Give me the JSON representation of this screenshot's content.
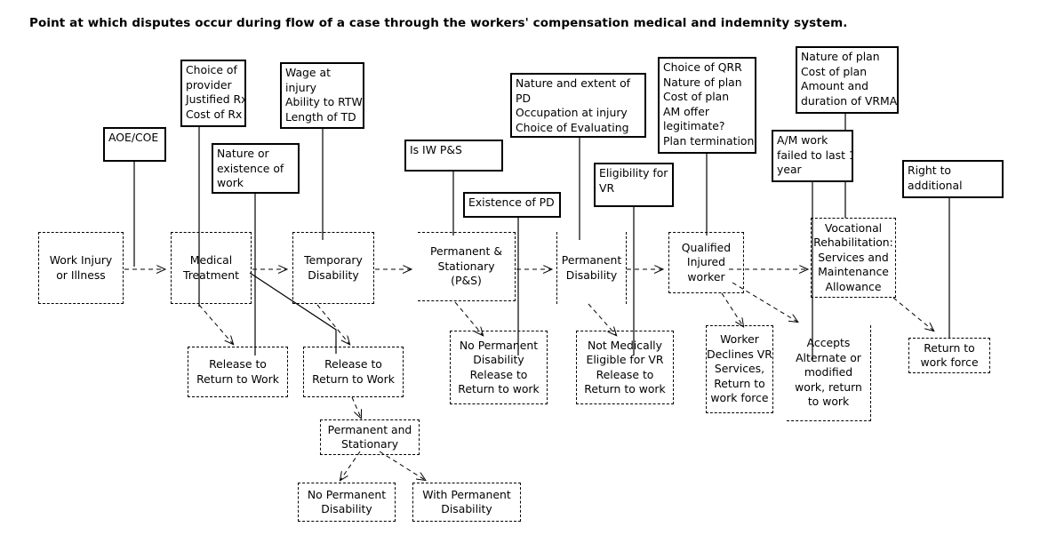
{
  "title": "Point at which disputes occur during flow of a case through the workers' compensation medical and indemnity system.",
  "dispute_boxes": [
    {
      "id": "aoe-coe",
      "text": "AOE/COE"
    },
    {
      "id": "choice-provider",
      "text": "Choice of\nprovider\nJustified Rx\nCost of Rx"
    },
    {
      "id": "wage-injury",
      "text": "Wage at\ninjury\nAbility to RTW\nLength of TD"
    },
    {
      "id": "nature-work",
      "text": "Nature or\nexistence of\nwork"
    },
    {
      "id": "is-iw-ps",
      "text": "Is IW P&S"
    },
    {
      "id": "existence-pd",
      "text": "Existence of PD"
    },
    {
      "id": "nature-extent-pd",
      "text": "Nature and extent of\nPD\nOccupation at injury\nChoice of Evaluating\nphysician"
    },
    {
      "id": "eligibility-vr",
      "text": "Eligibility for\nVR"
    },
    {
      "id": "choice-qrr",
      "text": "Choice of QRR\nNature of plan\nCost of plan\nAM offer\nlegitimate?\nPlan termination"
    },
    {
      "id": "nature-plan",
      "text": "Nature of plan\nCost of plan\nAmount and\nduration of VRMA"
    },
    {
      "id": "am-work-failed",
      "text": "A/M work\nfailed to last 1\nyear"
    },
    {
      "id": "right-additional",
      "text": "Right to\nadditional"
    }
  ],
  "process_boxes": [
    {
      "id": "work-injury",
      "text": "Work Injury\nor Illness"
    },
    {
      "id": "medical-treatment",
      "text": "Medical\nTreatment"
    },
    {
      "id": "temporary-disability",
      "text": "Temporary\nDisability"
    },
    {
      "id": "permanent-stationary",
      "text": "Permanent &\nStationary\n(P&S)"
    },
    {
      "id": "permanent-disability",
      "text": "Permanent\nDisability"
    },
    {
      "id": "qualified-injured-worker",
      "text": "Qualified\nInjured\nworker"
    },
    {
      "id": "vocational-rehab",
      "text": "Vocational\nRehabilitation:\nServices and\nMaintenance\nAllowance"
    },
    {
      "id": "release-rtw-1",
      "text": "Release to\nReturn to Work"
    },
    {
      "id": "release-rtw-2",
      "text": "Release to\nReturn to Work"
    },
    {
      "id": "no-pd-release",
      "text": "No Permanent\nDisability\nRelease to\nReturn to work"
    },
    {
      "id": "not-med-eligible",
      "text": "Not Medically\nEligible for VR\nRelease to\nReturn to work"
    },
    {
      "id": "worker-declines",
      "text": "Worker\nDeclines VR\nServices,\nReturn to\nwork force"
    },
    {
      "id": "accepts-alt-work",
      "text": "Accepts\nAlternate or\nmodified\nwork, return\nto work"
    },
    {
      "id": "return-workforce",
      "text": "Return to\nwork force"
    },
    {
      "id": "perm-and-stat",
      "text": "Permanent and\nStationary"
    },
    {
      "id": "no-perm-dis",
      "text": "No Permanent\nDisability"
    },
    {
      "id": "with-perm-dis",
      "text": "With Permanent\nDisability"
    }
  ],
  "colors": {
    "stroke": "#000000",
    "background": "#ffffff"
  }
}
